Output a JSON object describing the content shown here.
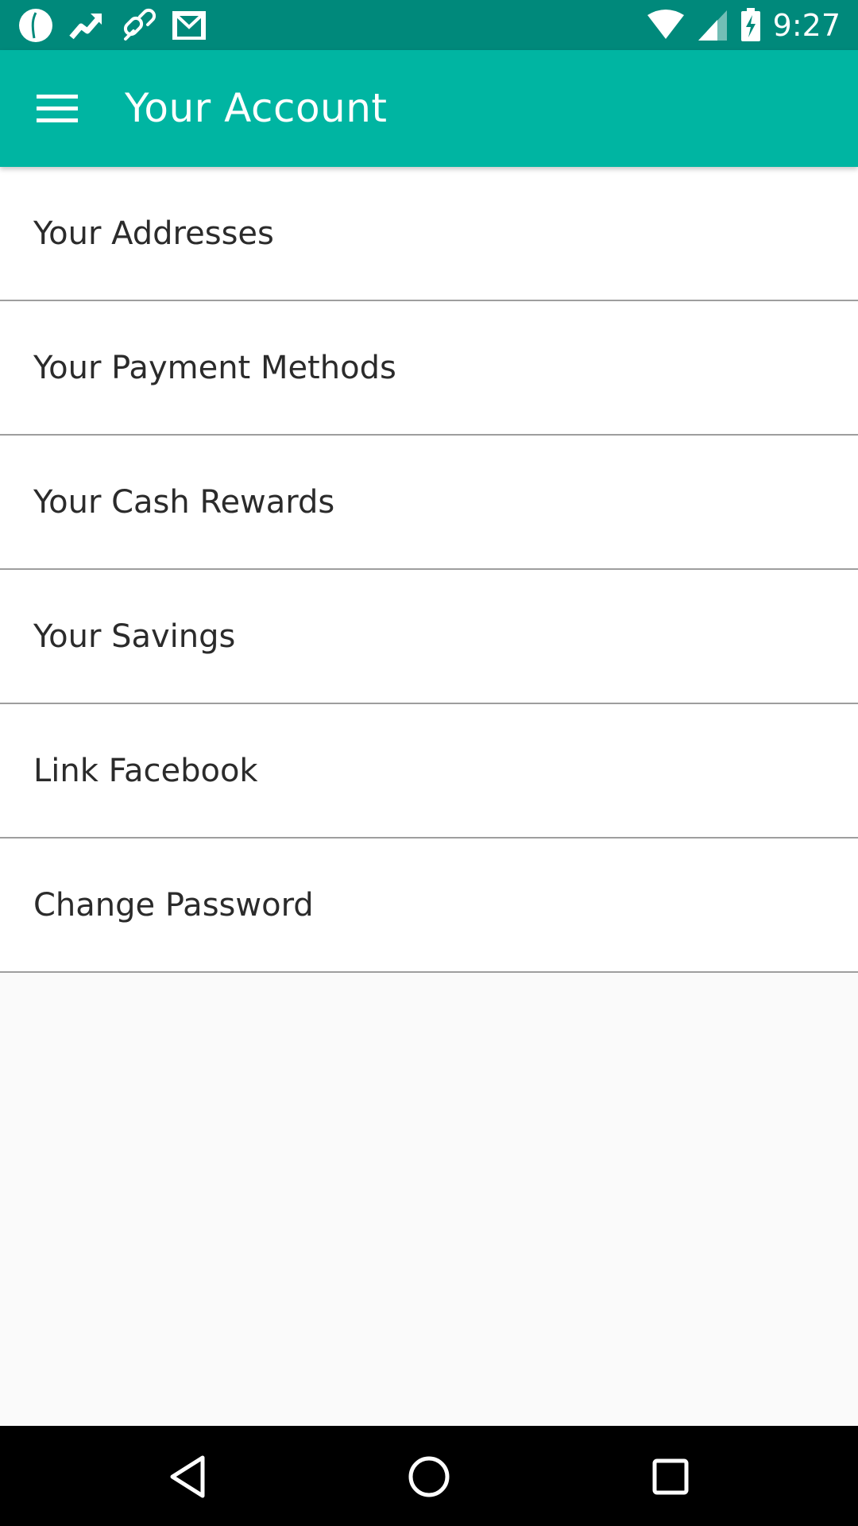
{
  "status_bar": {
    "time": "9:27",
    "left_icons": [
      "drop-icon",
      "trending-up-icon",
      "link-icon",
      "gmail-icon"
    ],
    "right_icons": [
      "wifi-icon",
      "cellular-signal-icon",
      "battery-charging-icon"
    ],
    "color": "#00897b"
  },
  "app_bar": {
    "title": "Your Account",
    "color": "#00b5a2",
    "menu_icon": "hamburger-menu-icon"
  },
  "menu": {
    "items": [
      {
        "label": "Your Addresses"
      },
      {
        "label": "Your Payment Methods"
      },
      {
        "label": "Your Cash Rewards"
      },
      {
        "label": "Your Savings"
      },
      {
        "label": "Link Facebook"
      },
      {
        "label": "Change Password"
      }
    ]
  },
  "nav_bar": {
    "buttons": [
      "back-icon",
      "home-icon",
      "recents-icon"
    ]
  }
}
